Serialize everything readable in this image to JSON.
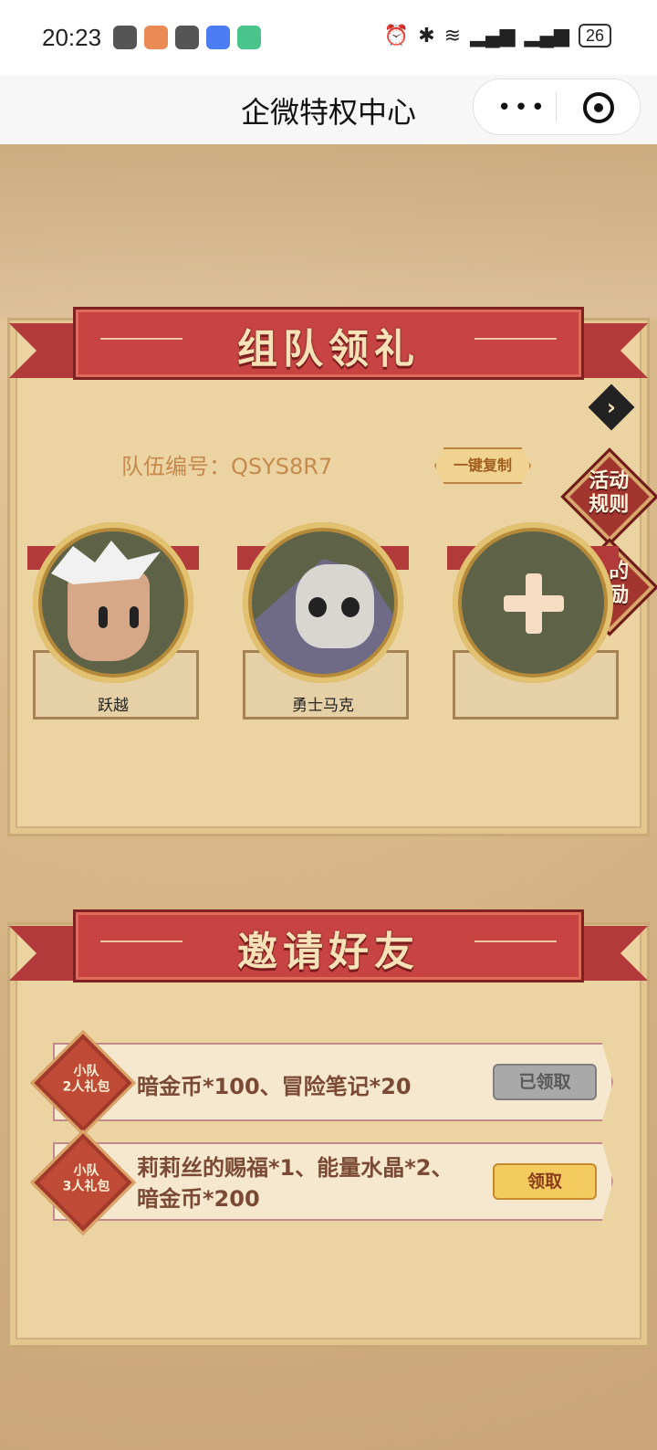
{
  "status_bar": {
    "time": "20:23",
    "battery": "26"
  },
  "nav": {
    "title": "企微特权中心",
    "more_label": "•••"
  },
  "sections": {
    "team": {
      "title": "组队领礼",
      "team_id_label": "队伍编号：QSYS8R7",
      "copy_button": "一键复制",
      "members": [
        {
          "name": "跃越"
        },
        {
          "name": "勇士马克"
        },
        {
          "name": ""
        }
      ]
    },
    "invite": {
      "title": "邀请好友",
      "rewards": [
        {
          "badge": "小队\n2人礼包",
          "text": "暗金币*100、冒险笔记*20",
          "button": "已领取",
          "claimed": true
        },
        {
          "badge": "小队\n3人礼包",
          "text": "莉莉丝的赐福*1、能量水晶*2、\n暗金币*200",
          "button": "领取",
          "claimed": false
        }
      ]
    }
  },
  "side_buttons": {
    "rules": "活动\n规则",
    "my_rewards": "我的\n奖励"
  },
  "icons": [
    "chevron-right-icon",
    "plus-icon",
    "target-icon",
    "more-icon"
  ]
}
